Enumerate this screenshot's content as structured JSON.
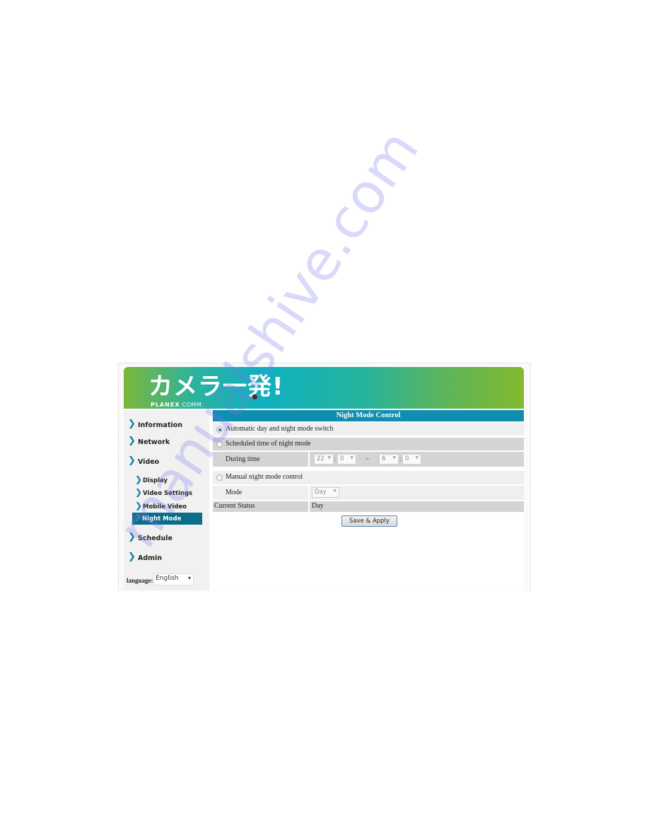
{
  "header": {
    "logo_text": "カメラ一発!",
    "brand_bold": "PLANEX",
    "brand_light": "COMM."
  },
  "sidebar": {
    "items": [
      {
        "label": "Information"
      },
      {
        "label": "Network"
      },
      {
        "label": "Video"
      },
      {
        "label": "Schedule"
      },
      {
        "label": "Admin"
      }
    ],
    "video_subitems": [
      {
        "label": "Display"
      },
      {
        "label": "Video Settings"
      },
      {
        "label": "Mobile Video"
      },
      {
        "label": "Night Mode",
        "active": true
      }
    ],
    "language_label": "language:",
    "language_value": "English"
  },
  "panel": {
    "title": "Night Mode Control",
    "options": {
      "auto": {
        "label": "Automatic day and night mode switch",
        "selected": true
      },
      "scheduled": {
        "label": "Scheduled time of night mode",
        "selected": false
      },
      "manual": {
        "label": "Manual night mode control",
        "selected": false
      }
    },
    "during_time": {
      "label": "During time",
      "start_hour": "22",
      "start_min": "0",
      "separator": "~",
      "end_hour": "6",
      "end_min": "0",
      "colon": ":"
    },
    "mode": {
      "label": "Mode",
      "value": "Day"
    },
    "current_status": {
      "label": "Current Status",
      "value": "Day"
    },
    "save_button": "Save & Apply"
  },
  "watermark": "manualshive.com",
  "colors": {
    "title_bar": "#0f8eaf",
    "active_nav": "#0b6d8a",
    "chevron": "#0a7ea8"
  }
}
